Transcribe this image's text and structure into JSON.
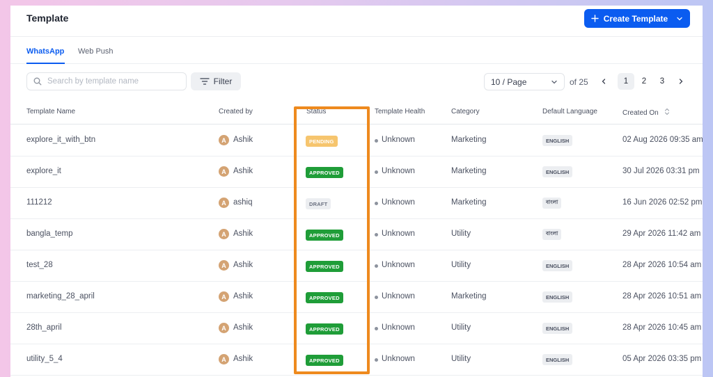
{
  "header": {
    "title": "Template",
    "create_button": "Create Template"
  },
  "tabs": [
    {
      "label": "WhatsApp",
      "active": true
    },
    {
      "label": "Web Push",
      "active": false
    }
  ],
  "toolbar": {
    "search_placeholder": "Search by template name",
    "filter_label": "Filter",
    "per_page": "10 / Page",
    "of_total": "of 25",
    "pages": [
      "1",
      "2",
      "3"
    ],
    "current_page": "1"
  },
  "columns": [
    "Template Name",
    "Created by",
    "Status",
    "Template Health",
    "Category",
    "Default Language",
    "Created On"
  ],
  "rows": [
    {
      "name": "explore_it_with_btn",
      "avatar": "A",
      "creator": "Ashik",
      "status": "PENDING",
      "health": "Unknown",
      "category": "Marketing",
      "language": "ENGLISH",
      "created": "02 Aug 2026 09:35 am"
    },
    {
      "name": "explore_it",
      "avatar": "A",
      "creator": "Ashik",
      "status": "APPROVED",
      "health": "Unknown",
      "category": "Marketing",
      "language": "ENGLISH",
      "created": "30 Jul 2026 03:31 pm"
    },
    {
      "name": "111212",
      "avatar": "A",
      "creator": "ashiq",
      "status": "DRAFT",
      "health": "Unknown",
      "category": "Marketing",
      "language": "বাংলা",
      "created": "16 Jun 2026 02:52 pm"
    },
    {
      "name": "bangla_temp",
      "avatar": "A",
      "creator": "Ashik",
      "status": "APPROVED",
      "health": "Unknown",
      "category": "Utility",
      "language": "বাংলা",
      "created": "29 Apr 2026 11:42 am"
    },
    {
      "name": "test_28",
      "avatar": "A",
      "creator": "Ashik",
      "status": "APPROVED",
      "health": "Unknown",
      "category": "Utility",
      "language": "ENGLISH",
      "created": "28 Apr 2026 10:54 am"
    },
    {
      "name": "marketing_28_april",
      "avatar": "A",
      "creator": "Ashik",
      "status": "APPROVED",
      "health": "Unknown",
      "category": "Marketing",
      "language": "ENGLISH",
      "created": "28 Apr 2026 10:51 am"
    },
    {
      "name": "28th_april",
      "avatar": "A",
      "creator": "Ashik",
      "status": "APPROVED",
      "health": "Unknown",
      "category": "Utility",
      "language": "ENGLISH",
      "created": "28 Apr 2026 10:45 am"
    },
    {
      "name": "utility_5_4",
      "avatar": "A",
      "creator": "Ashik",
      "status": "APPROVED",
      "health": "Unknown",
      "category": "Utility",
      "language": "ENGLISH",
      "created": "05 Apr 2026 03:35 pm"
    }
  ],
  "colors": {
    "accent": "#0b5cf0",
    "approved": "#1f9d38",
    "pending": "#f6c56e",
    "highlight": "#ee8a1e"
  }
}
